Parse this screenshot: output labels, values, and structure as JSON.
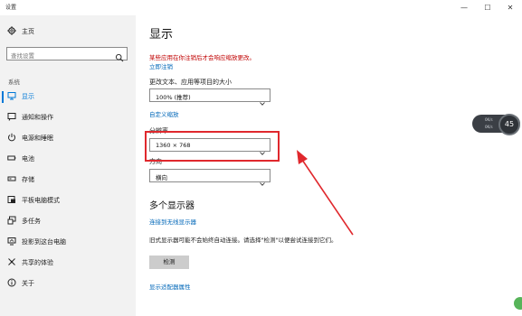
{
  "window": {
    "title": "设置",
    "minimize": "—",
    "maximize": "☐",
    "close": "✕"
  },
  "sidebar": {
    "home": {
      "label": "主页",
      "icon": "gear-icon"
    },
    "search_placeholder": "查找设置",
    "section_label": "系统",
    "items": [
      {
        "label": "显示",
        "icon": "monitor-icon",
        "active": true
      },
      {
        "label": "通知和操作",
        "icon": "notification-icon"
      },
      {
        "label": "电源和睡眠",
        "icon": "power-icon"
      },
      {
        "label": "电池",
        "icon": "battery-icon"
      },
      {
        "label": "存储",
        "icon": "storage-icon"
      },
      {
        "label": "平板电脑模式",
        "icon": "tablet-icon"
      },
      {
        "label": "多任务",
        "icon": "multitask-icon"
      },
      {
        "label": "投影到这台电脑",
        "icon": "project-icon"
      },
      {
        "label": "共享的体验",
        "icon": "share-icon"
      },
      {
        "label": "关于",
        "icon": "info-icon"
      }
    ]
  },
  "main": {
    "title": "显示",
    "warning": "某些应用在你注销后才会响应缩放更改。",
    "sign_out_link": "立即注销",
    "scale_label": "更改文本、应用等项目的大小",
    "scale_value": "100% (推荐)",
    "custom_scale_link": "自定义缩放",
    "resolution_label": "分辨率",
    "resolution_value": "1360 × 768",
    "orientation_label": "方向",
    "orientation_value": "横向",
    "multi_display_title": "多个显示器",
    "wireless_link": "连接到无线显示器",
    "detect_desc": "旧式显示器可能不会始终自动连接。请选择\"检测\"以便尝试连接到它们。",
    "detect_button": "检测",
    "adapter_link": "显示适配器属性"
  },
  "widget": {
    "line1": "0K/s",
    "line2": "0K/s",
    "gauge": "45"
  },
  "colors": {
    "accent": "#0078d7",
    "warning": "#c00000",
    "annotation": "#e0282d"
  }
}
